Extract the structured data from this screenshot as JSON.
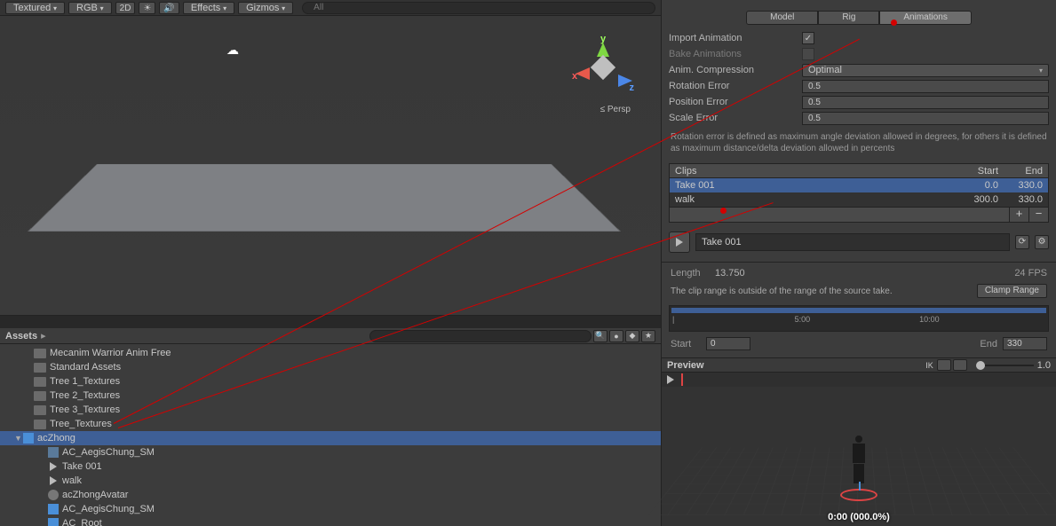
{
  "scene_toolbar": {
    "shading": "Textured",
    "render": "RGB",
    "mode_2d": "2D",
    "effects": "Effects",
    "gizmos": "Gizmos",
    "search_placeholder": "All"
  },
  "scene": {
    "axis_x": "x",
    "axis_y": "y",
    "axis_z": "z",
    "persp": "Persp"
  },
  "assets": {
    "title": "Assets",
    "items": [
      {
        "label": "Mecanim Warrior Anim Free",
        "type": "folder",
        "depth": 1
      },
      {
        "label": "Standard Assets",
        "type": "folder",
        "depth": 1
      },
      {
        "label": "Tree 1_Textures",
        "type": "folder",
        "depth": 1
      },
      {
        "label": "Tree 2_Textures",
        "type": "folder",
        "depth": 1
      },
      {
        "label": "Tree 3_Textures",
        "type": "folder",
        "depth": 1
      },
      {
        "label": "Tree_Textures",
        "type": "folder",
        "depth": 1
      },
      {
        "label": "acZhong",
        "type": "prefab",
        "depth": 0,
        "selected": true,
        "arrow": "▼"
      },
      {
        "label": "AC_AegisChung_SM",
        "type": "mesh",
        "depth": 2
      },
      {
        "label": "Take 001",
        "type": "anim",
        "depth": 2
      },
      {
        "label": "walk",
        "type": "anim",
        "depth": 2
      },
      {
        "label": "acZhongAvatar",
        "type": "avatar",
        "depth": 2
      },
      {
        "label": "AC_AegisChung_SM",
        "type": "prefab",
        "depth": 2
      },
      {
        "label": "AC_Root",
        "type": "prefab",
        "depth": 2
      }
    ]
  },
  "inspector": {
    "tabs": {
      "model": "Model",
      "rig": "Rig",
      "animations": "Animations"
    },
    "import_animation": "Import Animation",
    "bake_animations": "Bake Animations",
    "anim_compression": "Anim. Compression",
    "anim_compression_val": "Optimal",
    "rotation_error": "Rotation Error",
    "rotation_error_val": "0.5",
    "position_error": "Position Error",
    "position_error_val": "0.5",
    "scale_error": "Scale Error",
    "scale_error_val": "0.5",
    "help": "Rotation error is defined as maximum angle deviation allowed in degrees, for others it is defined as maximum distance/delta deviation allowed in percents",
    "clips_header": {
      "c1": "Clips",
      "c2": "Start",
      "c3": "End"
    },
    "clips": [
      {
        "name": "Take 001",
        "start": "0.0",
        "end": "330.0",
        "sel": true
      },
      {
        "name": "walk",
        "start": "300.0",
        "end": "330.0"
      }
    ],
    "clip_name": "Take 001",
    "length_label": "Length",
    "length_val": "13.750",
    "fps": "24 FPS",
    "warn": "The clip range is outside of the range of the source take.",
    "clamp": "Clamp Range",
    "ticks": {
      "t2": "5:00",
      "t3": "10:00"
    },
    "start_label": "Start",
    "start_val": "0",
    "end_label": "End",
    "end_val": "330"
  },
  "preview": {
    "title": "Preview",
    "ik": "IK",
    "zoom": "1.0",
    "timestamp": "0:00 (000.0%)"
  }
}
